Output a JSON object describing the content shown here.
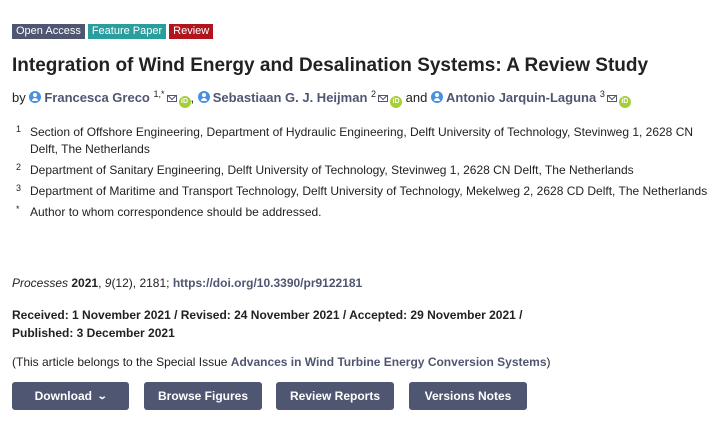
{
  "badges": {
    "open_access": "Open Access",
    "feature_paper": "Feature Paper",
    "review": "Review"
  },
  "title": "Integration of Wind Energy and Desalination Systems: A Review Study",
  "authors": {
    "by": "by",
    "list": [
      {
        "name": "Francesca Greco",
        "sup": "1,*"
      },
      {
        "name": "Sebastiaan G. J. Heijman",
        "sup": "2"
      },
      {
        "name": "Antonio Jarquin-Laguna",
        "sup": "3"
      }
    ],
    "separator_comma": ",",
    "separator_and": "and"
  },
  "affiliations": [
    {
      "num": "1",
      "text": "Section of Offshore Engineering, Department of Hydraulic Engineering, Delft University of Technology, Stevinweg 1, 2628 CN Delft, The Netherlands"
    },
    {
      "num": "2",
      "text": "Department of Sanitary Engineering, Delft University of Technology, Stevinweg 1, 2628 CN Delft, The Netherlands"
    },
    {
      "num": "3",
      "text": "Department of Maritime and Transport Technology, Delft University of Technology, Mekelweg 2, 2628 CD Delft, The Netherlands"
    },
    {
      "num": "*",
      "text": "Author to whom correspondence should be addressed."
    }
  ],
  "citation": {
    "journal": "Processes",
    "year": "2021",
    "volume": "9",
    "issue": "(12)",
    "article": ", 2181; ",
    "doi": "https://doi.org/10.3390/pr9122181"
  },
  "dates": {
    "line1": "Received: 1 November 2021 / Revised: 24 November 2021 / Accepted: 29 November 2021 /",
    "line2": "Published: 3 December 2021"
  },
  "special_issue": {
    "prefix": "(This article belongs to the Special Issue ",
    "name": "Advances in Wind Turbine Energy Conversion Systems",
    "suffix": ")"
  },
  "buttons": {
    "download": "Download",
    "browse_figures": "Browse Figures",
    "review_reports": "Review Reports",
    "versions_notes": "Versions Notes"
  },
  "colors": {
    "primary": "#4f5671",
    "feature": "#2a9d9f",
    "review": "#b1141c",
    "orcid": "#a6ce39",
    "author_icon": "#4a90e2"
  },
  "icons": {
    "author": "person-icon",
    "email": "mail-icon",
    "orcid": "orcid-icon",
    "download_menu": "chevron-down-icon"
  }
}
